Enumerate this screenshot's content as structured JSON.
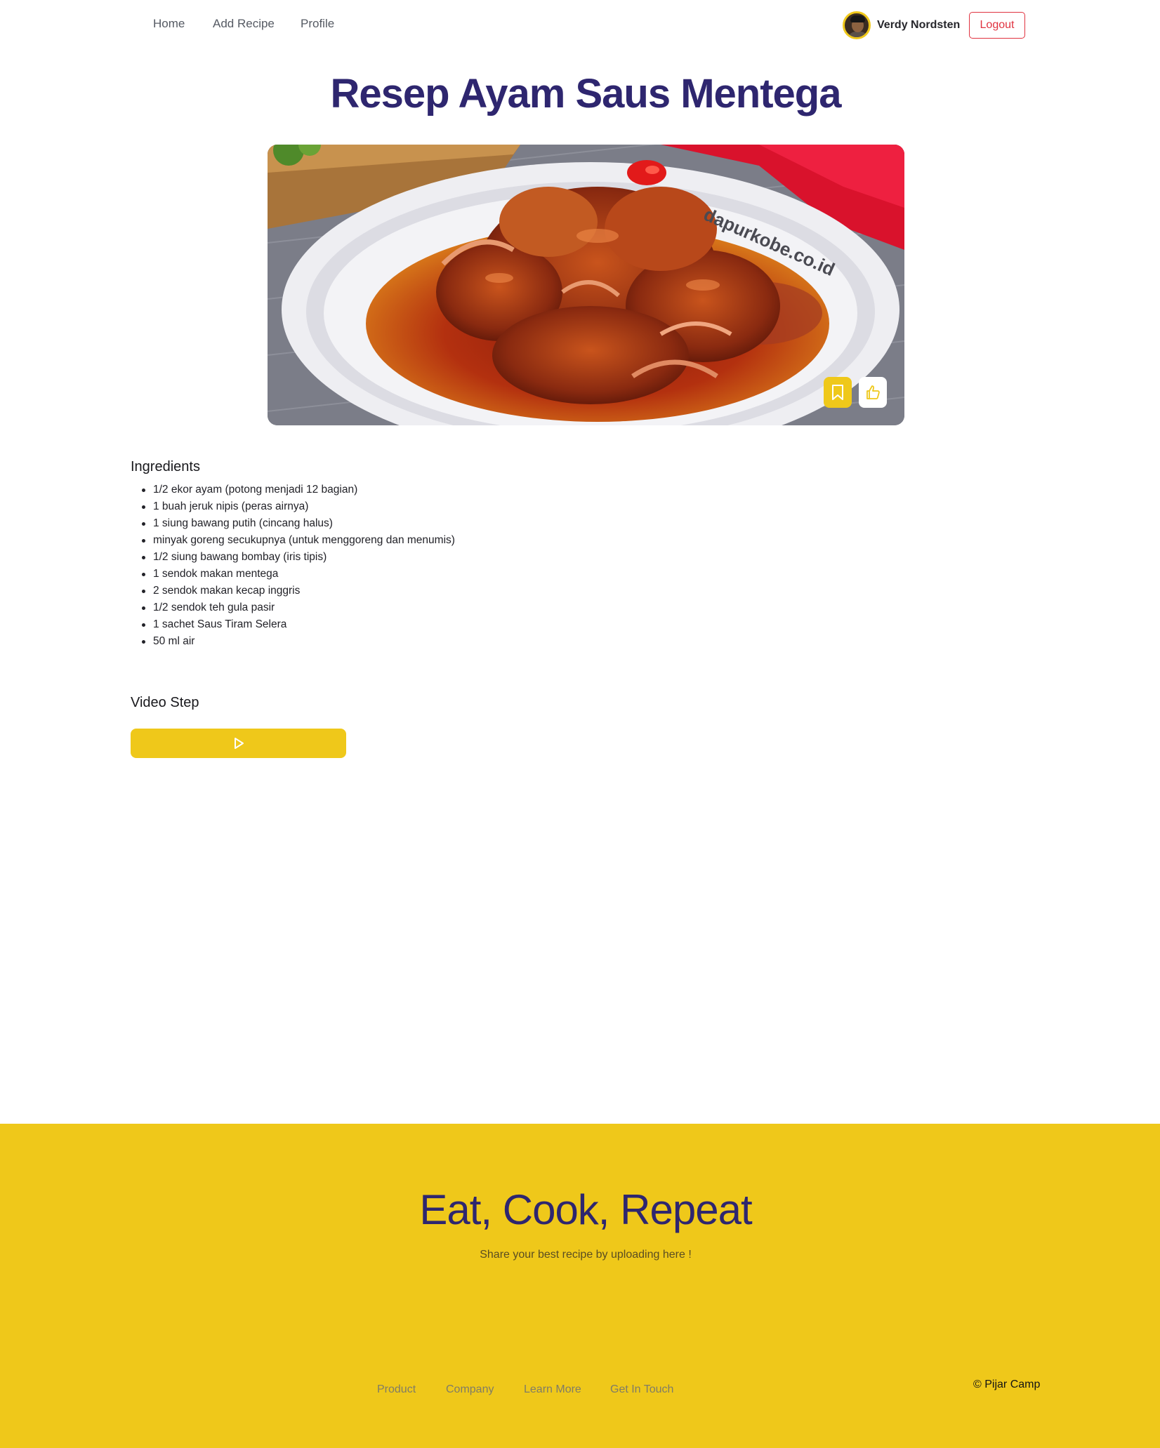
{
  "nav": {
    "links": [
      "Home",
      "Add Recipe",
      "Profile"
    ],
    "user_name": "Verdy Nordsten",
    "logout_label": "Logout",
    "avatar_icon": "user-avatar"
  },
  "recipe": {
    "title": "Resep Ayam Saus Mentega",
    "image_watermark": "dapurkobe.co.id",
    "save_icon": "bookmark-icon",
    "like_icon": "thumbs-up-icon",
    "ingredients_title": "Ingredients",
    "ingredients": [
      "1/2 ekor ayam (potong menjadi 12 bagian)",
      "1 buah jeruk nipis (peras airnya)",
      "1 siung bawang putih (cincang halus)",
      "minyak goreng secukupnya (untuk menggoreng dan menumis)",
      "1/2 siung bawang bombay (iris tipis)",
      "1 sendok makan mentega",
      "2 sendok makan kecap inggris",
      "1/2 sendok teh gula pasir",
      "1 sachet Saus Tiram Selera",
      "50 ml air"
    ],
    "video_title": "Video Step",
    "play_icon": "play-icon"
  },
  "footer": {
    "headline": "Eat, Cook, Repeat",
    "subtitle": "Share your best recipe by uploading here !",
    "links": [
      "Product",
      "Company",
      "Learn More",
      "Get In Touch"
    ],
    "copyright": "© Pijar Camp"
  },
  "colors": {
    "accent_yellow": "#efc81a",
    "title_navy": "#2e266f",
    "logout_red": "#e0323f"
  }
}
